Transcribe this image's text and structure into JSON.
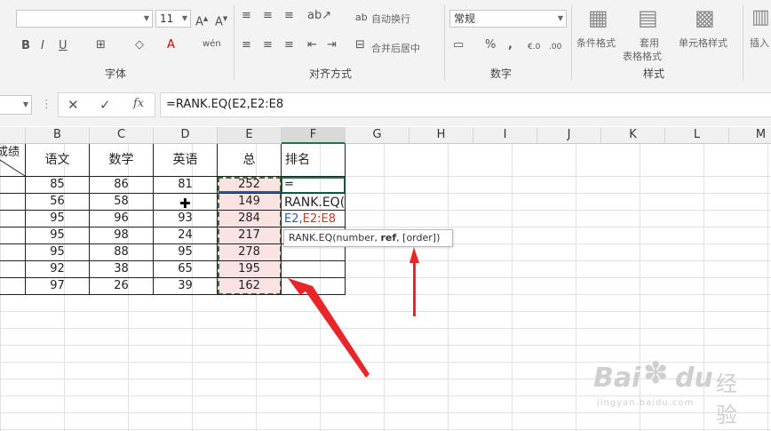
{
  "ribbon": {
    "font_name": "",
    "font_size": "11",
    "font_group_label": "字体",
    "align_group_label": "对齐方式",
    "wrap_label": "自动换行",
    "merge_label": "合并后居中",
    "number_format": "常规",
    "number_group_label": "数字",
    "cond_format_label": "条件格式",
    "table_format_label_1": "套用",
    "table_format_label_2": "表格格式",
    "cell_style_label": "单元格样式",
    "styles_group_label": "样式",
    "insert_label": "插入"
  },
  "formula_bar": {
    "formula": "=RANK.EQ(E2,E2:E8"
  },
  "columns": [
    "B",
    "C",
    "D",
    "E",
    "F",
    "G",
    "H",
    "I",
    "J",
    "K",
    "L",
    "M"
  ],
  "table": {
    "corner_text": "成绩",
    "headers": [
      "语文",
      "数学",
      "英语",
      "总",
      "排名"
    ],
    "rows": [
      [
        "85",
        "86",
        "81",
        "252"
      ],
      [
        "56",
        "58",
        "77",
        "149"
      ],
      [
        "95",
        "96",
        "93",
        "284"
      ],
      [
        "95",
        "98",
        "24",
        "217"
      ],
      [
        "95",
        "88",
        "95",
        "278"
      ],
      [
        "92",
        "38",
        "65",
        "195"
      ],
      [
        "97",
        "26",
        "39",
        "162"
      ]
    ]
  },
  "editing": {
    "line1": "=",
    "line2": "RANK.EQ(",
    "line3_a": "E2,",
    "line3_b": "E2:E8"
  },
  "tooltip": {
    "prefix": "RANK.EQ(number, ",
    "bold": "ref",
    "suffix": ", [order])"
  },
  "watermark": {
    "brand": "Bai",
    "brand2": "du",
    "cn": "经验",
    "url": "jingyan.baidu.com"
  },
  "colors": {
    "accent_red": "#e8262a",
    "ref_blue": "#2f5aa8",
    "ref_red": "#c0392b"
  }
}
